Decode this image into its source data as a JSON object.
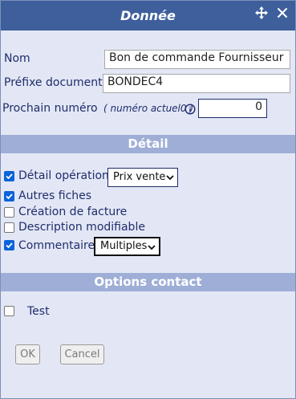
{
  "title": "Donnée",
  "fields": {
    "nom_label": "Nom",
    "nom_value": "Bon de commande Fournisseur",
    "prefixe_label": "Préfixe document",
    "prefixe_value": "BONDEC4",
    "prochain_label": "Prochain numéro",
    "prochain_hint": "( numéro actuel0 )",
    "prochain_value": "0"
  },
  "detail": {
    "header": "Détail",
    "items": [
      {
        "label": "Détail opération",
        "checked": true,
        "select": "Prix vente"
      },
      {
        "label": "Autres fiches",
        "checked": true
      },
      {
        "label": "Création de facture",
        "checked": false
      },
      {
        "label": "Description modifiable",
        "checked": false
      },
      {
        "label": "Commentaire",
        "checked": true,
        "select": "Multiples"
      }
    ]
  },
  "options_contact": {
    "header": "Options contact",
    "items": [
      {
        "label": "Test",
        "checked": false
      }
    ]
  },
  "buttons": {
    "ok": "OK",
    "cancel": "Cancel"
  },
  "colors": {
    "titlebar": "#3e5f9c",
    "section": "#9eaed6",
    "panel": "#e3e7f5",
    "checkbox": "#0b63d8",
    "text": "#1f2d6b"
  }
}
